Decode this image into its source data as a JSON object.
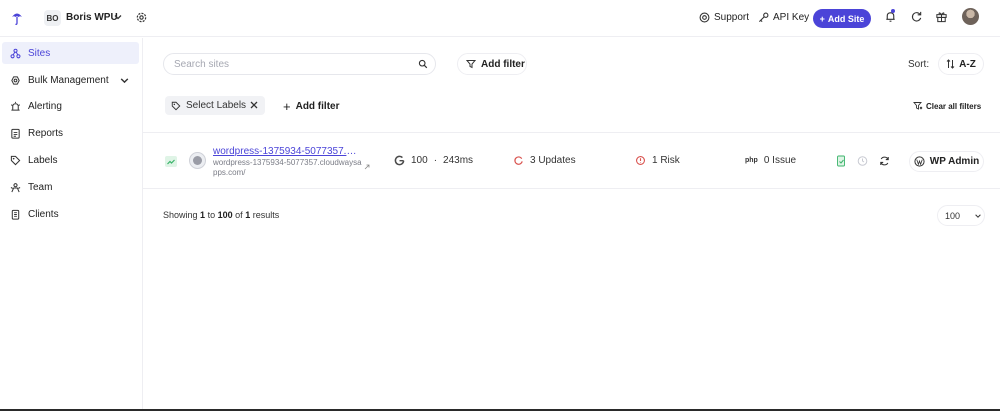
{
  "workspace": {
    "badge": "BO",
    "name": "Boris WPU"
  },
  "topbar": {
    "support_label": "Support",
    "api_key_label": "API Key",
    "add_site_label": "Add Site"
  },
  "sidebar": {
    "items": [
      {
        "label": "Sites",
        "icon": "sites-icon"
      },
      {
        "label": "Bulk Management",
        "icon": "bulk-icon"
      },
      {
        "label": "Alerting",
        "icon": "alert-icon"
      },
      {
        "label": "Reports",
        "icon": "reports-icon"
      },
      {
        "label": "Labels",
        "icon": "label-icon"
      },
      {
        "label": "Team",
        "icon": "team-icon"
      },
      {
        "label": "Clients",
        "icon": "clients-icon"
      }
    ]
  },
  "toolbar": {
    "search_placeholder": "Search sites",
    "add_filter_label": "Add filter",
    "sort_label": "Sort:",
    "sort_value": "A-Z"
  },
  "filters": {
    "select_labels": "Select Labels",
    "add_filter_label": "Add filter",
    "clear_all_label": "Clear all filters"
  },
  "site": {
    "title": "wordpress-1375934-5077357.clo...",
    "url": "wordpress-1375934-5077357.cloudwaysapps.com/",
    "score": "100",
    "load_time": "243ms",
    "updates": "3 Updates",
    "risks": "1 Risk",
    "issues": "0 Issue",
    "wp_admin_label": "WP Admin"
  },
  "pagination": {
    "showing_prefix": "Showing",
    "from": "1",
    "to_word": "to",
    "to": "100",
    "of_word": "of",
    "total": "1",
    "results_word": "results",
    "per_page": "100"
  },
  "colors": {
    "accent": "#4b44d8",
    "success": "#3ab36a",
    "danger": "#d9534f"
  }
}
